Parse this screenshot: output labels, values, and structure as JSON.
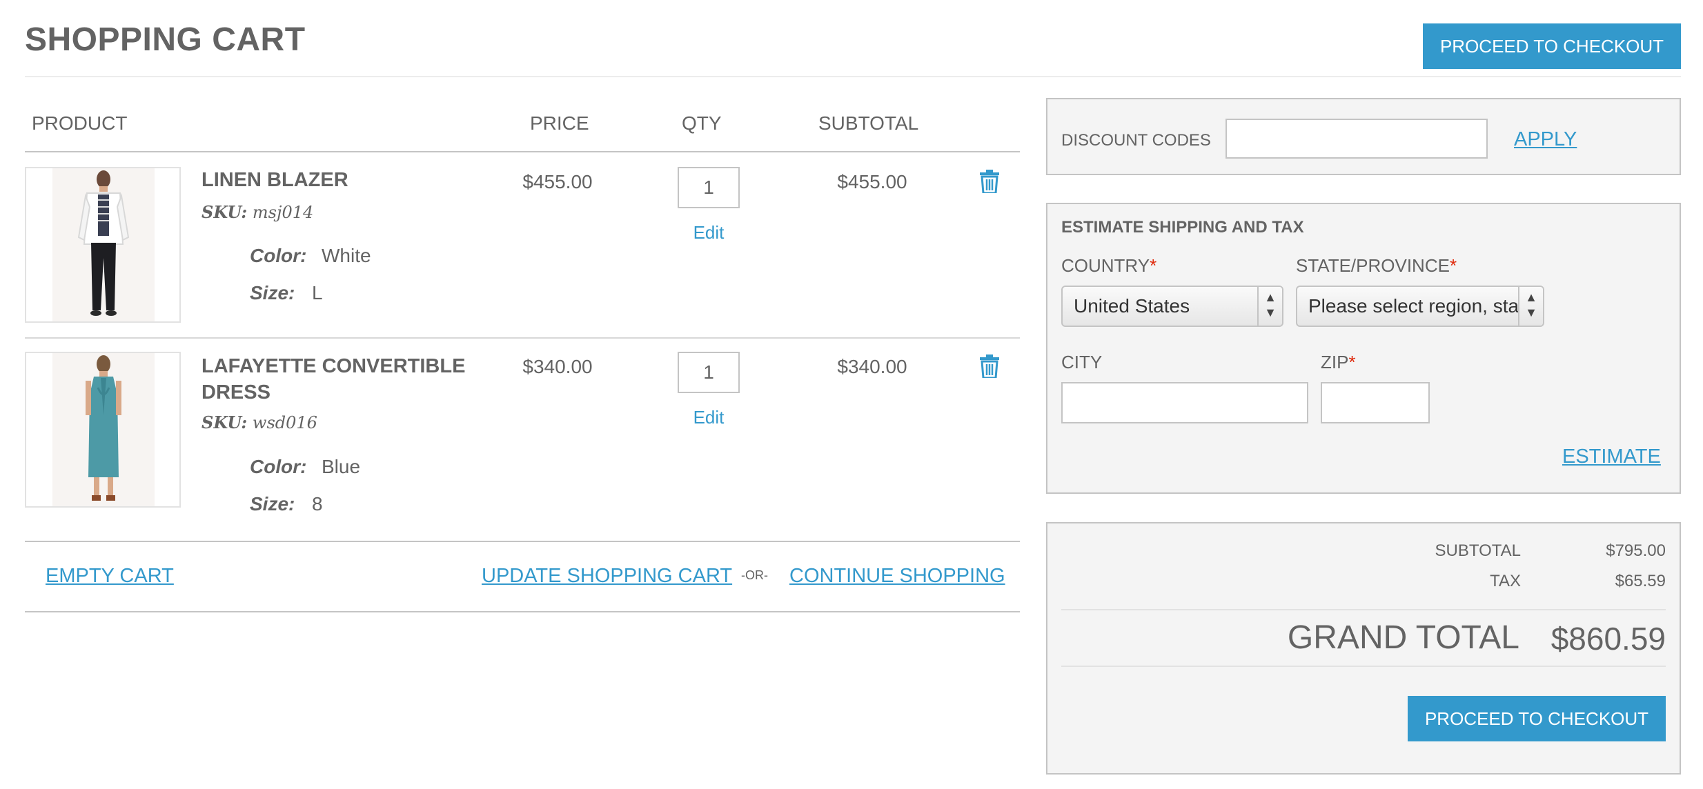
{
  "header": {
    "title": "SHOPPING CART",
    "checkout_label": "PROCEED TO CHECKOUT"
  },
  "table": {
    "headers": {
      "product": "PRODUCT",
      "price": "PRICE",
      "qty": "QTY",
      "subtotal": "SUBTOTAL"
    }
  },
  "items": [
    {
      "name": "LINEN BLAZER",
      "sku_label": "SKU:",
      "sku": "msj014",
      "options": [
        {
          "label": "Color:",
          "value": "White"
        },
        {
          "label": "Size:",
          "value": "L"
        }
      ],
      "price": "$455.00",
      "qty": "1",
      "edit_label": "Edit",
      "subtotal": "$455.00",
      "delete_icon": "trash-icon",
      "image_icon": "product-photo-white-blazer"
    },
    {
      "name": "LAFAYETTE CONVERTIBLE DRESS",
      "sku_label": "SKU:",
      "sku": "wsd016",
      "options": [
        {
          "label": "Color:",
          "value": "Blue"
        },
        {
          "label": "Size:",
          "value": "8"
        }
      ],
      "price": "$340.00",
      "qty": "1",
      "edit_label": "Edit",
      "subtotal": "$340.00",
      "delete_icon": "trash-icon",
      "image_icon": "product-photo-teal-dress"
    }
  ],
  "actions": {
    "empty_cart": "EMPTY CART",
    "update_cart": "UPDATE SHOPPING CART",
    "or": "-OR-",
    "continue_shopping": "CONTINUE SHOPPING"
  },
  "discount": {
    "label": "DISCOUNT CODES",
    "value": "",
    "apply_label": "APPLY"
  },
  "shipping": {
    "title": "ESTIMATE SHIPPING AND TAX",
    "country_label": "COUNTRY",
    "country_value": "United States",
    "state_label": "STATE/PROVINCE",
    "state_value": "Please select region, state or province",
    "city_label": "CITY",
    "city_value": "",
    "zip_label": "ZIP",
    "zip_value": "",
    "required_mark": "*",
    "estimate_label": "ESTIMATE"
  },
  "totals": {
    "subtotal_label": "SUBTOTAL",
    "subtotal_value": "$795.00",
    "tax_label": "TAX",
    "tax_value": "$65.59",
    "grand_total_label": "GRAND TOTAL",
    "grand_total_value": "$860.59",
    "checkout_label": "PROCEED TO CHECKOUT"
  },
  "colors": {
    "accent": "#3399cc",
    "text": "#636363",
    "required": "#df280a",
    "panel_bg": "#f4f4f4"
  }
}
